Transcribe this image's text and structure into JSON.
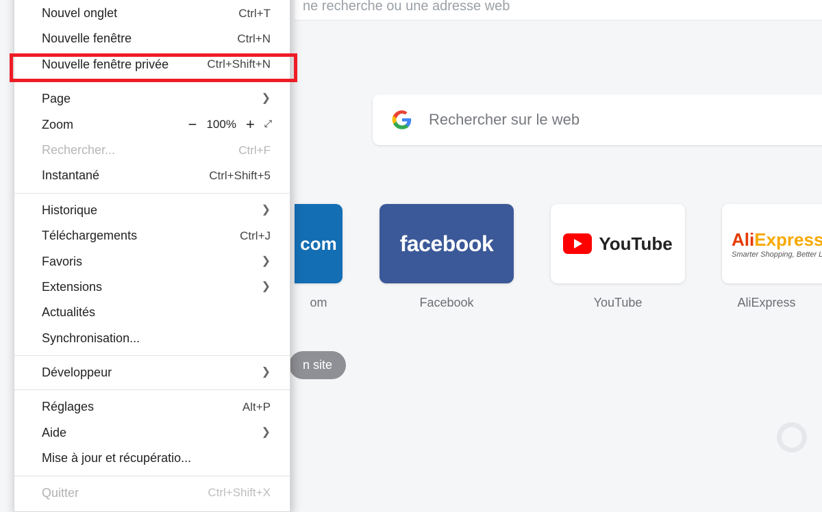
{
  "address_hint": "ne recherche ou une adresse web",
  "search": {
    "placeholder": "Rechercher sur le web"
  },
  "add_site_partial": "n site",
  "speed_dials": [
    {
      "id": "amazon",
      "caption": "om",
      "tile_text": "com"
    },
    {
      "id": "facebook",
      "caption": "Facebook",
      "tile_text": "facebook"
    },
    {
      "id": "youtube",
      "caption": "YouTube",
      "tile_text": "YouTube"
    },
    {
      "id": "aliexpress",
      "caption": "AliExpress",
      "tile_text": "AliExpress",
      "tile_sub": "Smarter Shopping, Better Livi"
    }
  ],
  "menu": {
    "new_tab": {
      "label": "Nouvel onglet",
      "shortcut": "Ctrl+T"
    },
    "new_window": {
      "label": "Nouvelle fenêtre",
      "shortcut": "Ctrl+N"
    },
    "new_private": {
      "label": "Nouvelle fenêtre privée",
      "shortcut": "Ctrl+Shift+N"
    },
    "page": {
      "label": "Page"
    },
    "zoom": {
      "label": "Zoom",
      "minus": "−",
      "value": "100%",
      "plus": "+"
    },
    "find": {
      "label": "Rechercher...",
      "shortcut": "Ctrl+F"
    },
    "snapshot": {
      "label": "Instantané",
      "shortcut": "Ctrl+Shift+5"
    },
    "history": {
      "label": "Historique"
    },
    "downloads": {
      "label": "Téléchargements",
      "shortcut": "Ctrl+J"
    },
    "bookmarks": {
      "label": "Favoris"
    },
    "extensions": {
      "label": "Extensions"
    },
    "news": {
      "label": "Actualités"
    },
    "sync": {
      "label": "Synchronisation..."
    },
    "developer": {
      "label": "Développeur"
    },
    "settings": {
      "label": "Réglages",
      "shortcut": "Alt+P"
    },
    "help": {
      "label": "Aide"
    },
    "update": {
      "label": "Mise à jour et récupératio..."
    },
    "quit": {
      "label": "Quitter",
      "shortcut": "Ctrl+Shift+X"
    }
  }
}
